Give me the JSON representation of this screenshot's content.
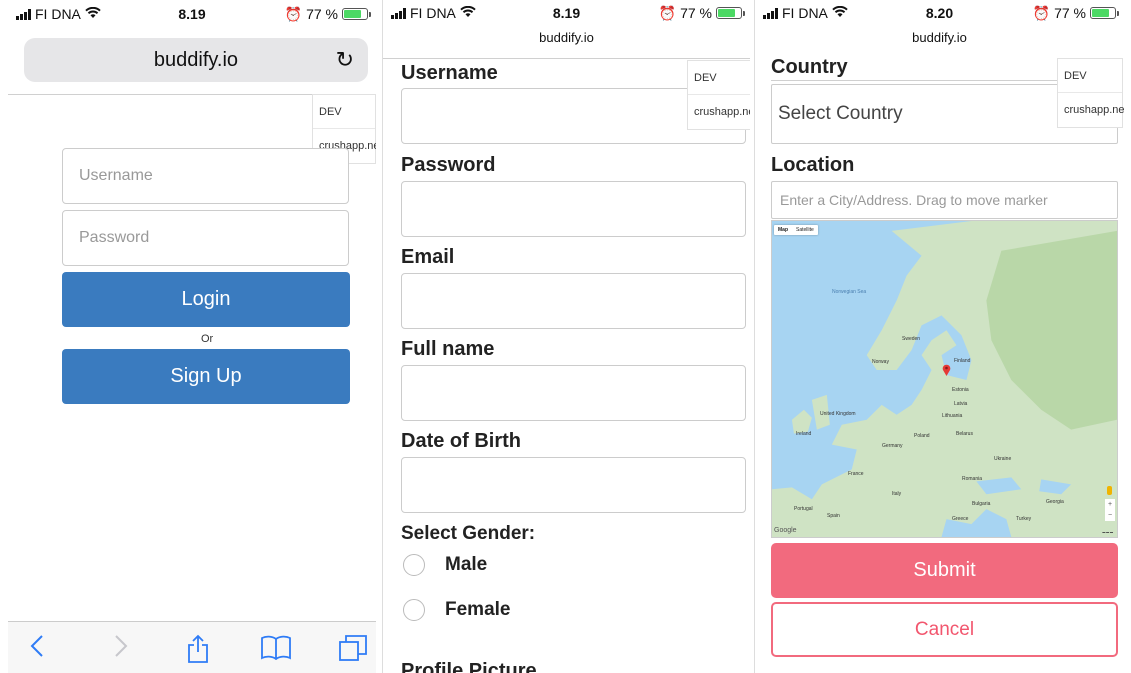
{
  "status": {
    "carrier": "FI DNA",
    "battery": "77 %",
    "battery_level": 0.77
  },
  "phone1": {
    "time": "8.19",
    "domain": "buddify.io",
    "dev_menu": [
      "DEV",
      "crushapp.net"
    ],
    "username_placeholder": "Username",
    "password_placeholder": "Password",
    "login_label": "Login",
    "or_label": "Or",
    "signup_label": "Sign Up"
  },
  "phone2": {
    "time": "8.19",
    "domain": "buddify.io",
    "dev_menu": [
      "DEV",
      "crushapp.net"
    ],
    "fields": [
      "Username",
      "Password",
      "Email",
      "Full name",
      "Date of Birth"
    ],
    "gender_label": "Select Gender:",
    "gender_options": [
      "Male",
      "Female"
    ],
    "cut_label": "Profile Picture"
  },
  "phone3": {
    "time": "8.20",
    "domain": "buddify.io",
    "dev_menu": [
      "DEV",
      "crushapp.net"
    ],
    "country_label": "Country",
    "country_select": "Select Country",
    "location_label": "Location",
    "location_placeholder": "Enter a City/Address. Drag to move marker",
    "map_tabs": [
      "Map",
      "Satellite"
    ],
    "map_labels": {
      "finland": "Finland",
      "sweden": "Sweden",
      "norway": "Norway",
      "estonia": "Estonia",
      "latvia": "Latvia",
      "lithuania": "Lithuania",
      "uk": "United Kingdom",
      "ireland": "Ireland",
      "poland": "Poland",
      "germany": "Germany",
      "france": "France",
      "ukraine": "Ukraine",
      "belarus": "Belarus",
      "spain": "Spain",
      "portugal": "Portugal",
      "italy": "Italy",
      "romania": "Romania",
      "turkey": "Turkey",
      "greece": "Greece",
      "bulgaria": "Bulgaria",
      "georgia": "Georgia",
      "norwegian_sea": "Norwegian Sea"
    },
    "map_google": "Google",
    "submit_label": "Submit",
    "cancel_label": "Cancel"
  }
}
